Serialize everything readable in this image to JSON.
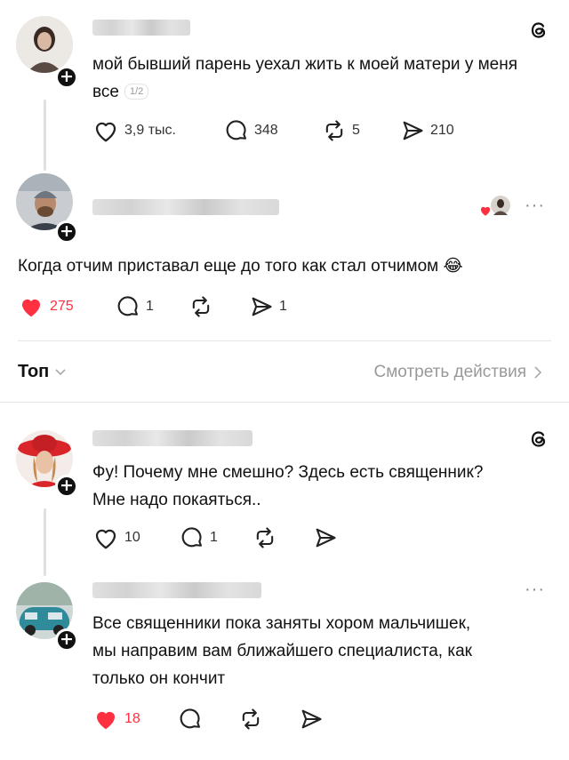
{
  "post1": {
    "text": "мой бывший парень уехал жить к моей матери у меня все",
    "pager": "1/2",
    "likes": "3,9 тыс.",
    "comments": "348",
    "reposts": "5",
    "shares": "210"
  },
  "reply1": {
    "text": "Когда отчим приставал еще до того как стал отчимом",
    "emoji": "😂",
    "likes": "275",
    "comments": "1",
    "shares": "1"
  },
  "sort": {
    "label": "Топ",
    "view_activity": "Смотреть действия"
  },
  "post2": {
    "text_line1": "Фу! Почему мне смешно? Здесь есть священник?",
    "text_line2": "Мне надо покаяться..",
    "likes": "10",
    "comments": "1"
  },
  "reply2": {
    "text_line1": "Все священники пока заняты хором мальчишек,",
    "text_line2": "мы направим вам ближайшего специалиста, как",
    "text_line3": "только он кончит",
    "likes": "18"
  },
  "colors": {
    "like_red": "#ff3040",
    "text": "#111111",
    "muted": "#999999"
  }
}
